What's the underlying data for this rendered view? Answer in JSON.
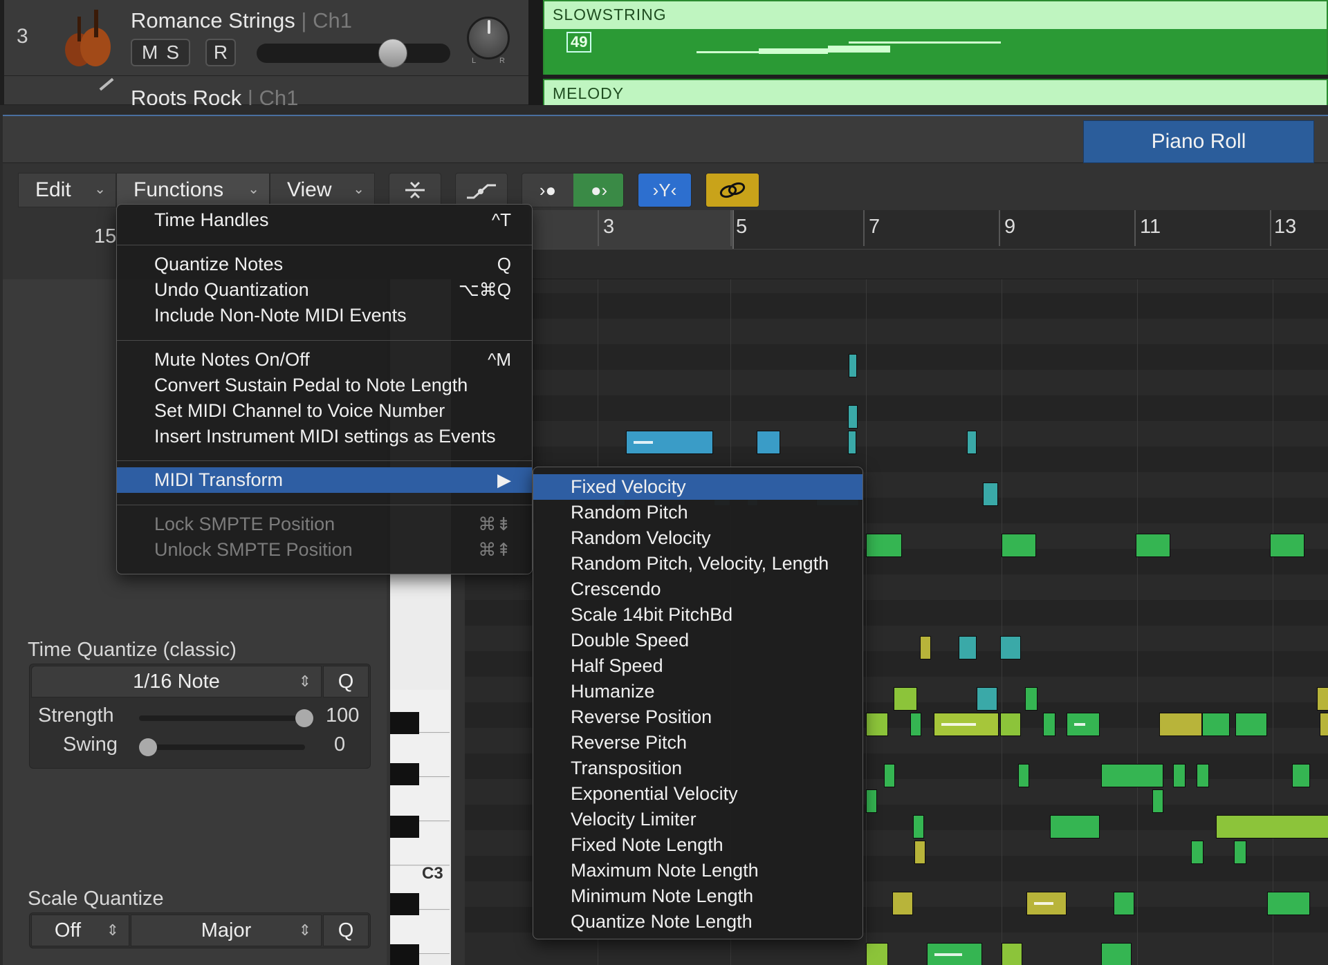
{
  "tracks": [
    {
      "number": "3",
      "name": "Romance Strings",
      "channel": "Ch1",
      "mute": "M",
      "solo": "S",
      "record": "R",
      "pan_l": "L",
      "pan_r": "R"
    },
    {
      "name": "Roots Rock",
      "channel": "Ch1"
    }
  ],
  "regions": [
    {
      "name": "SLOWSTRING",
      "marker": "49"
    },
    {
      "name": "MELODY"
    }
  ],
  "window": {
    "tab": "Piano Roll"
  },
  "toolbar": {
    "edit": "Edit",
    "functions": "Functions",
    "view": "View"
  },
  "ruler": {
    "left_bar": "15",
    "bars": [
      "3",
      "5",
      "7",
      "9",
      "11",
      "13"
    ]
  },
  "inspector": {
    "time_quantize_title": "Time Quantize (classic)",
    "time_quantize_value": "1/16 Note",
    "q": "Q",
    "strength_label": "Strength",
    "strength_value": "100",
    "strength_level": 1.0,
    "swing_label": "Swing",
    "swing_value": "0",
    "swing_level": 0.0,
    "scale_quantize_title": "Scale Quantize",
    "scale_off": "Off",
    "scale_major": "Major"
  },
  "keyboard": {
    "c3": "C3"
  },
  "functions_menu": [
    {
      "label": "Time Handles",
      "shortcut": "^T"
    },
    {
      "label": "Quantize Notes",
      "shortcut": "Q"
    },
    {
      "label": "Undo Quantization",
      "shortcut": "⌥⌘Q"
    },
    {
      "label": "Include Non-Note MIDI Events",
      "shortcut": ""
    },
    {
      "label": "Mute Notes On/Off",
      "shortcut": "^M"
    },
    {
      "label": "Convert Sustain Pedal to Note Length",
      "shortcut": ""
    },
    {
      "label": "Set MIDI Channel to Voice Number",
      "shortcut": ""
    },
    {
      "label": "Insert Instrument MIDI settings as Events",
      "shortcut": ""
    },
    {
      "label": "MIDI Transform",
      "shortcut": "▶"
    },
    {
      "label": "Lock SMPTE Position",
      "shortcut": "⌘⇟"
    },
    {
      "label": "Unlock SMPTE Position",
      "shortcut": "⌘⇞"
    }
  ],
  "midi_transform_menu": [
    "Fixed Velocity",
    "Random Pitch",
    "Random Velocity",
    "Random Pitch, Velocity, Length",
    "Crescendo",
    "Scale 14bit PitchBd",
    "Double Speed",
    "Half Speed",
    "Humanize",
    "Reverse Position",
    "Reverse Pitch",
    "Transposition",
    "Exponential Velocity",
    "Velocity Limiter",
    "Fixed Note Length",
    "Maximum Note Length",
    "Minimum Note Length",
    "Quantize Note Length"
  ],
  "colors": {
    "accent": "#2e5ea3",
    "region_bg": "#bff5c0",
    "region_body": "#2b9a35",
    "link_button": "#c9a31a",
    "catch_button": "#2d6fcf",
    "note_blue": "#3a9cc7",
    "note_green": "#35b552",
    "note_yellow": "#b8b43a"
  }
}
